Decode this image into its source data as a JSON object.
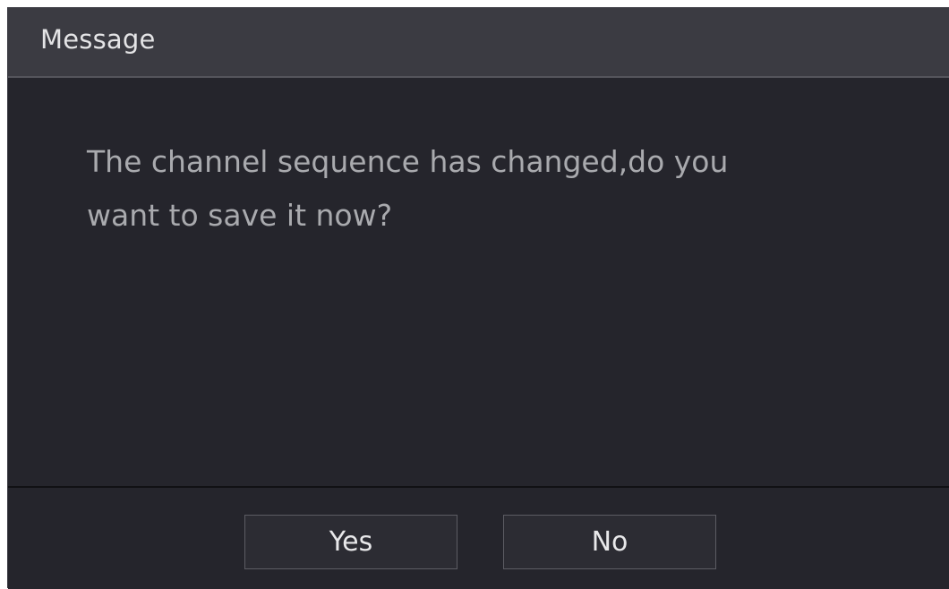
{
  "dialog": {
    "title": "Message",
    "message_lines": [
      "The channel sequence has changed,do you",
      "want to save it now?"
    ],
    "yes_label": "Yes",
    "no_label": "No"
  },
  "colors": {
    "title_bar": "#3b3b42",
    "body": "#25252c",
    "message_text": "#a9aaae",
    "button_border": "#5c5c63"
  }
}
